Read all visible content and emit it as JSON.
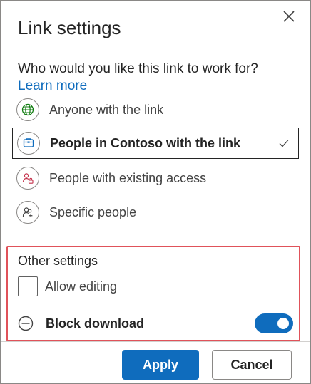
{
  "dialog": {
    "title": "Link settings",
    "close_icon": "close-icon"
  },
  "audience": {
    "question": "Who would you like this link to work for?",
    "learn_more": "Learn more",
    "options": [
      {
        "label": "Anyone with the link",
        "icon": "globe-icon",
        "color": "#107c10",
        "selected": false
      },
      {
        "label": "People in Contoso with the link",
        "icon": "building-icon",
        "color": "#0f6cbd",
        "selected": true
      },
      {
        "label": "People with existing access",
        "icon": "people-lock-icon",
        "color": "#c4314b",
        "selected": false
      },
      {
        "label": "Specific people",
        "icon": "people-add-icon",
        "color": "#424242",
        "selected": false
      }
    ]
  },
  "other_settings": {
    "title": "Other settings",
    "allow_editing": {
      "label": "Allow editing",
      "checked": false
    },
    "block_download": {
      "label": "Block download",
      "icon": "block-icon",
      "enabled": true
    }
  },
  "buttons": {
    "apply": "Apply",
    "cancel": "Cancel"
  },
  "colors": {
    "accent": "#0f6cbd",
    "highlight_border": "#e0525a"
  }
}
